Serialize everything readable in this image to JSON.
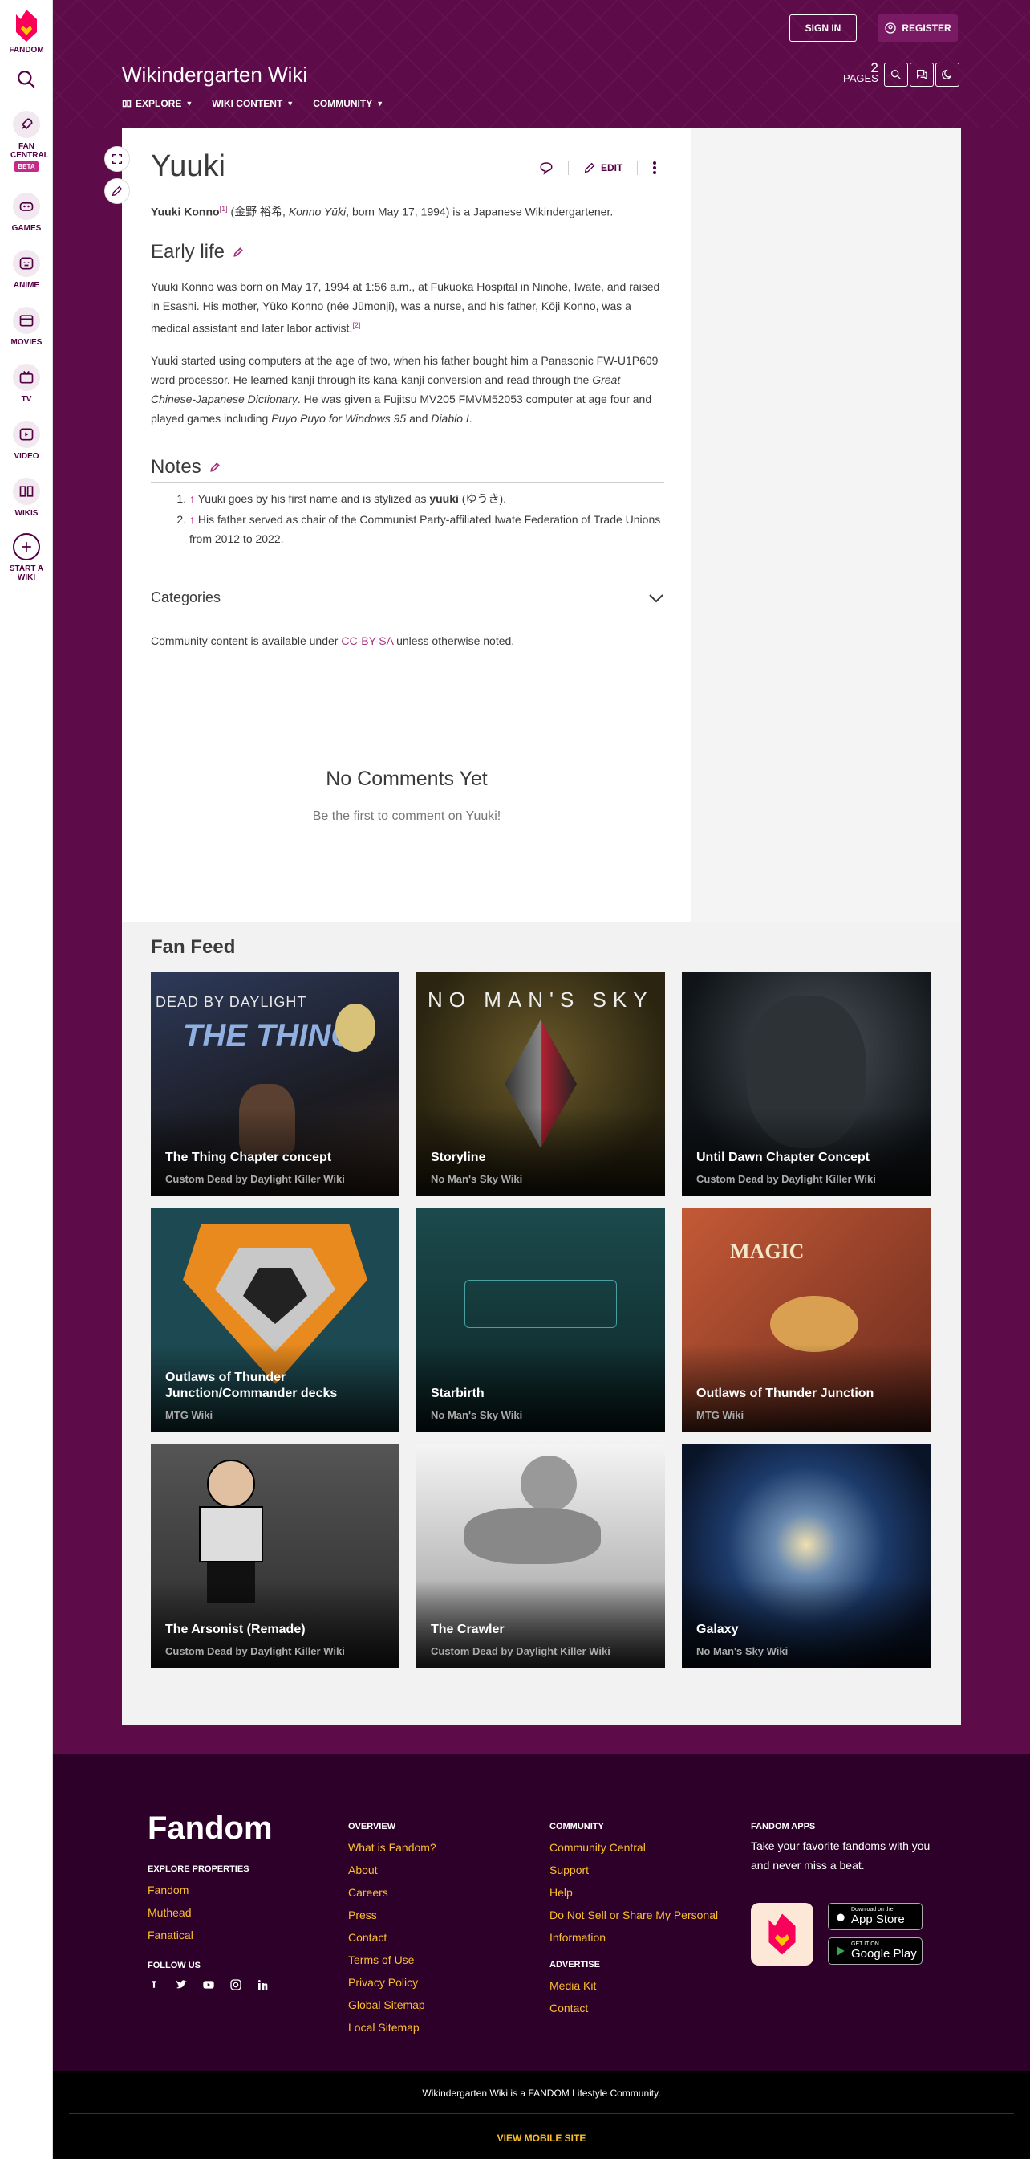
{
  "global_nav": {
    "fandom_label": "FANDOM",
    "fan_central": "FAN CENTRAL",
    "beta": "BETA",
    "games": "GAMES",
    "anime": "ANIME",
    "movies": "MOVIES",
    "tv": "TV",
    "video": "VIDEO",
    "wikis": "WIKIS",
    "start_wiki": "START A WIKI"
  },
  "header": {
    "wiki_name": "Wikindergarten Wiki",
    "sign_in": "SIGN IN",
    "register": "REGISTER",
    "pages_count": "2",
    "pages_label": "PAGES",
    "nav": [
      "EXPLORE",
      "WIKI CONTENT",
      "COMMUNITY"
    ]
  },
  "article": {
    "title": "Yuuki",
    "edit_label": "EDIT",
    "intro": {
      "bold_name": "Yuuki Konno",
      "ref1": "[1]",
      "kanji": " (金野 裕希, ",
      "romaji": "Konno Yūki",
      "rest": ", born May 17, 1994) is a Japanese Wikindergartener."
    },
    "early_life_heading": "Early life",
    "early_p1": "Yuuki Konno was born on May 17, 1994 at 1:56 a.m., at Fukuoka Hospital in Ninohe, Iwate, and raised in Esashi. His mother, Yūko Konno (née Jūmonji), was a nurse, and his father, Kōji Konno, was a medical assistant and later labor activist.",
    "ref2": "[2]",
    "early_p2_a": "Yuuki started using computers at the age of two, when his father bought him a Panasonic FW-U1P609 word processor. He learned kanji through its kana-kanji conversion and read through the ",
    "early_p2_b": "Great Chinese-Japanese Dictionary",
    "early_p2_c": ". He was given a Fujitsu MV205 FMVM52053 computer at age four and played games including ",
    "early_p2_d": "Puyo Puyo for Windows 95",
    "early_p2_e": " and ",
    "early_p2_f": "Diablo I",
    "early_p2_g": ".",
    "notes_heading": "Notes",
    "note1_a": " Yuuki goes by his first name and is stylized as ",
    "note1_b": "yuuki",
    "note1_c": " (ゆうき).",
    "note2": " His father served as chair of the Communist Party-affiliated Iwate Federation of Trade Unions from 2012 to 2022.",
    "arrow": "↑",
    "categories": "Categories",
    "license_a": "Community content is available under ",
    "license_link": "CC-BY-SA",
    "license_b": " unless otherwise noted.",
    "no_comments": "No Comments Yet",
    "be_first": "Be the first to comment on Yuuki!"
  },
  "fan_feed": {
    "title": "Fan Feed",
    "cards": [
      {
        "title": "The Thing Chapter concept",
        "wiki": "Custom Dead by Daylight Killer Wiki",
        "art_text": "DEAD BY DAYLIGHT",
        "art_sub": "THE THING"
      },
      {
        "title": "Storyline",
        "wiki": "No Man's Sky Wiki",
        "art_text": "NO MAN'S SKY"
      },
      {
        "title": "Until Dawn Chapter Concept",
        "wiki": "Custom Dead by Daylight Killer Wiki"
      },
      {
        "title": "Outlaws of Thunder Junction/Commander decks",
        "wiki": "MTG Wiki"
      },
      {
        "title": "Starbirth",
        "wiki": "No Man's Sky Wiki"
      },
      {
        "title": "Outlaws of Thunder Junction",
        "wiki": "MTG Wiki",
        "art_text": "MAGIC"
      },
      {
        "title": "The Arsonist (Remade)",
        "wiki": "Custom Dead by Daylight Killer Wiki"
      },
      {
        "title": "The Crawler",
        "wiki": "Custom Dead by Daylight Killer Wiki"
      },
      {
        "title": "Galaxy",
        "wiki": "No Man's Sky Wiki"
      }
    ]
  },
  "footer": {
    "logo": "Fandom",
    "explore_heading": "EXPLORE PROPERTIES",
    "explore_links": [
      "Fandom",
      "Muthead",
      "Fanatical"
    ],
    "follow_heading": "FOLLOW US",
    "overview_heading": "OVERVIEW",
    "overview_links": [
      "What is Fandom?",
      "About",
      "Careers",
      "Press",
      "Contact",
      "Terms of Use",
      "Privacy Policy",
      "Global Sitemap",
      "Local Sitemap"
    ],
    "community_heading": "COMMUNITY",
    "community_links": [
      "Community Central",
      "Support",
      "Help",
      "Do Not Sell or Share My Personal Information"
    ],
    "advertise_heading": "ADVERTISE",
    "advertise_links": [
      "Media Kit",
      "Contact"
    ],
    "apps_heading": "FANDOM APPS",
    "apps_text": "Take your favorite fandoms with you and never miss a beat.",
    "app_store_small": "Download on the",
    "app_store": "App Store",
    "google_small": "GET IT ON",
    "google": "Google Play",
    "community_note": "Wikindergarten Wiki is a FANDOM Lifestyle Community.",
    "mobile": "VIEW MOBILE SITE"
  },
  "colors": {
    "brand_purple": "#5e0b49",
    "link_gold": "#fbbe2e",
    "accent_pink": "#c52a8b"
  }
}
